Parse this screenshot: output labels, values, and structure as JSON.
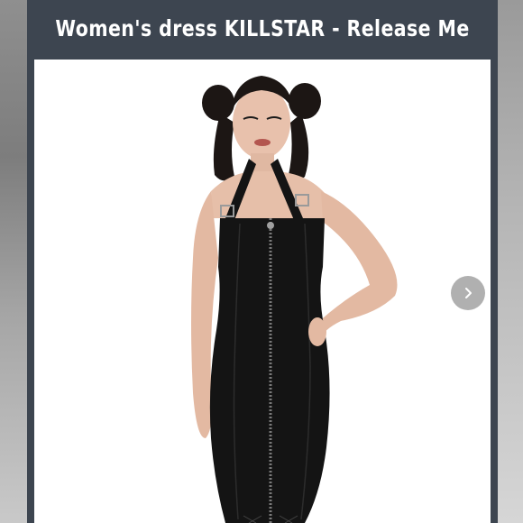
{
  "listing": {
    "title": "Women's dress KILLSTAR - Release Me"
  },
  "gallery": {
    "image_subject": "model-in-black-denim-halter-dress-with-front-zip",
    "next_icon": "chevron-right-icon"
  },
  "colors": {
    "frame": "#3d4550",
    "title_text": "#ffffff",
    "image_background": "#ffffff",
    "dress": "#141414",
    "nav_button": "#969696"
  }
}
